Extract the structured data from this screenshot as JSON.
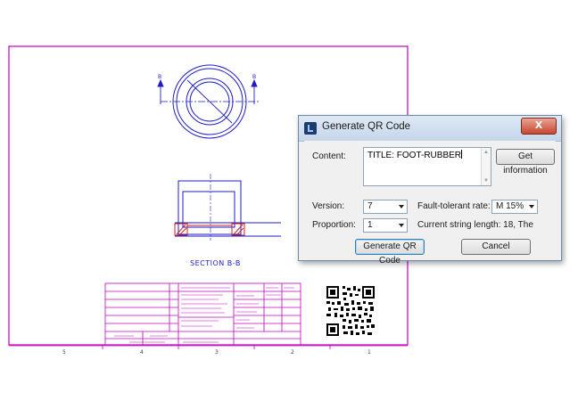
{
  "drawing": {
    "section_label": "SECTION B-B",
    "section_marker": "B",
    "border_numbers": [
      "5",
      "4",
      "3",
      "2",
      "1"
    ],
    "colors": {
      "frame": "#c000c0",
      "part": "#1e1ec8",
      "hatch": "#d02020"
    }
  },
  "dialog": {
    "title": "Generate QR Code",
    "close_label": "X",
    "content_label": "Content:",
    "content_value": "TITLE: FOOT-RUBBER",
    "get_info_label": "Get information",
    "version_label": "Version:",
    "version_value": "7",
    "fault_label": "Fault-tolerant rate:",
    "fault_value": "M 15%",
    "proportion_label": "Proportion:",
    "proportion_value": "1",
    "string_length": "Current string length: 18, The",
    "generate_label": "Generate QR Code",
    "cancel_label": "Cancel"
  }
}
